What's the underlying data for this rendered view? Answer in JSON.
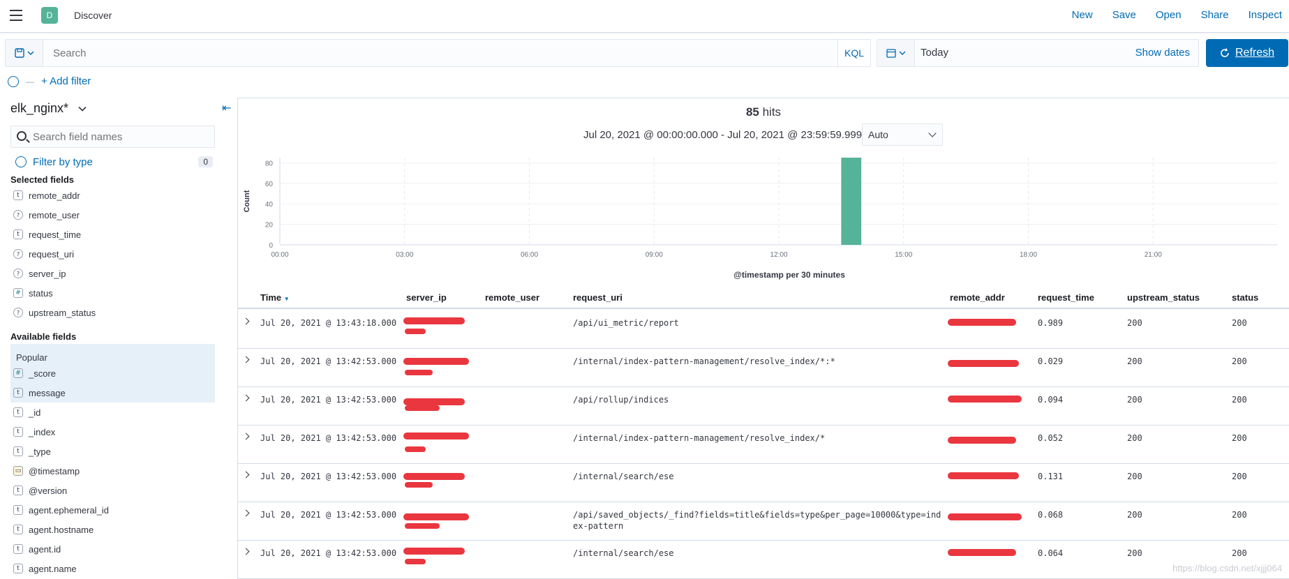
{
  "colors": {
    "accent": "#006bb4",
    "space_badge": "#54b399",
    "bar": "#54b399",
    "redaction": "#e8202a"
  },
  "header": {
    "space_initial": "D",
    "breadcrumb": "Discover",
    "links": [
      "New",
      "Save",
      "Open",
      "Share",
      "Inspect"
    ]
  },
  "query": {
    "placeholder": "Search",
    "language": "KQL"
  },
  "date": {
    "value": "Today",
    "show_dates": "Show dates",
    "refresh": "Refresh"
  },
  "filters": {
    "add_label": "+ Add filter"
  },
  "sidebar": {
    "index_pattern": "elk_nginx*",
    "search_placeholder": "Search field names",
    "filter_by_type": "Filter by type",
    "filter_count": "0",
    "selected_title": "Selected fields",
    "selected": [
      {
        "type": "t",
        "name": "remote_addr"
      },
      {
        "type": "?",
        "name": "remote_user"
      },
      {
        "type": "t",
        "name": "request_time"
      },
      {
        "type": "?",
        "name": "request_uri"
      },
      {
        "type": "?",
        "name": "server_ip"
      },
      {
        "type": "#",
        "name": "status"
      },
      {
        "type": "?",
        "name": "upstream_status"
      }
    ],
    "available_title": "Available fields",
    "popular_title": "Popular",
    "popular": [
      {
        "type": "#",
        "name": "_score"
      },
      {
        "type": "t",
        "name": "message"
      }
    ],
    "available": [
      {
        "type": "t",
        "name": "_id"
      },
      {
        "type": "t",
        "name": "_index"
      },
      {
        "type": "t",
        "name": "_type"
      },
      {
        "type": "cal",
        "name": "@timestamp"
      },
      {
        "type": "t",
        "name": "@version"
      },
      {
        "type": "t",
        "name": "agent.ephemeral_id"
      },
      {
        "type": "t",
        "name": "agent.hostname"
      },
      {
        "type": "t",
        "name": "agent.id"
      },
      {
        "type": "t",
        "name": "agent.name"
      }
    ]
  },
  "main": {
    "hits_count": "85",
    "hits_label": "hits",
    "range": "Jul 20, 2021 @ 00:00:00.000 - Jul 20, 2021 @ 23:59:59.999",
    "interval": "Auto"
  },
  "chart_data": {
    "type": "bar",
    "x_unit": "time of day",
    "bars": [
      {
        "x_start": "13:30",
        "x_end": "14:00",
        "value": 85
      }
    ],
    "xticks": [
      "00:00",
      "03:00",
      "06:00",
      "09:00",
      "12:00",
      "15:00",
      "18:00",
      "21:00"
    ],
    "yticks": [
      0,
      20,
      40,
      60,
      80
    ],
    "xlim": [
      "00:00",
      "24:00"
    ],
    "ylim": [
      0,
      85
    ],
    "ylabel": "Count",
    "xlabel": "@timestamp per 30 minutes",
    "grid": true
  },
  "table": {
    "columns": [
      "Time",
      "server_ip",
      "remote_user",
      "request_uri",
      "remote_addr",
      "request_time",
      "upstream_status",
      "status"
    ],
    "rows": [
      {
        "time": "Jul 20, 2021 @ 13:43:18.000",
        "uri": [
          "/api/ui_metric/report"
        ],
        "request_time": "0.989",
        "upstream_status": "200",
        "status": "200"
      },
      {
        "time": "Jul 20, 2021 @ 13:42:53.000",
        "uri": [
          "/internal/index-pattern-management/resolve_index/*:*"
        ],
        "request_time": "0.029",
        "upstream_status": "200",
        "status": "200"
      },
      {
        "time": "Jul 20, 2021 @ 13:42:53.000",
        "uri": [
          "/api/rollup/indices"
        ],
        "request_time": "0.094",
        "upstream_status": "200",
        "status": "200"
      },
      {
        "time": "Jul 20, 2021 @ 13:42:53.000",
        "uri": [
          "/internal/index-pattern-management/resolve_index/*"
        ],
        "request_time": "0.052",
        "upstream_status": "200",
        "status": "200"
      },
      {
        "time": "Jul 20, 2021 @ 13:42:53.000",
        "uri": [
          "/internal/search/ese"
        ],
        "request_time": "0.131",
        "upstream_status": "200",
        "status": "200"
      },
      {
        "time": "Jul 20, 2021 @ 13:42:53.000",
        "uri": [
          "/api/saved_objects/_find?fields=title&fields=type&per_page=10000&type=ind",
          "ex-pattern"
        ],
        "request_time": "0.068",
        "upstream_status": "200",
        "status": "200"
      },
      {
        "time": "Jul 20, 2021 @ 13:42:53.000",
        "uri": [
          "/internal/search/ese"
        ],
        "request_time": "0.064",
        "upstream_status": "200",
        "status": "200"
      }
    ]
  },
  "watermark": "https://blog.csdn.net/xjjj064"
}
